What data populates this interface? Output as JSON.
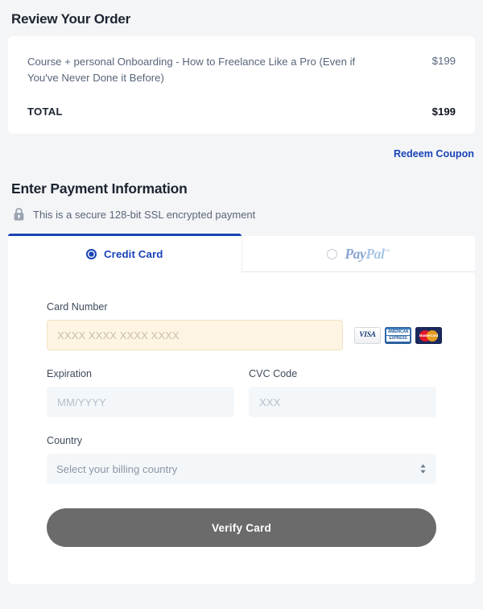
{
  "review": {
    "title": "Review Your Order",
    "item_name": "Course + personal Onboarding - How to Freelance Like a Pro (Even if You've Never Done it Before)",
    "item_price": "$199",
    "total_label": "TOTAL",
    "total_price": "$199"
  },
  "coupon": {
    "label": "Redeem Coupon",
    "color": "#1a43b8"
  },
  "payment": {
    "title": "Enter Payment Information",
    "ssl_notice": "This is a secure 128-bit SSL encrypted payment",
    "lock_icon": "lock-icon"
  },
  "tabs": [
    {
      "id": "credit-card",
      "label": "Credit Card",
      "selected": true,
      "radio_icon": "radio-selected-icon"
    },
    {
      "id": "paypal",
      "label": "PayPal",
      "logo_pay": "Pay",
      "logo_pal": "Pal",
      "trademark": "™",
      "selected": false,
      "radio_icon": "radio-unselected-icon"
    }
  ],
  "form": {
    "card_number": {
      "label": "Card Number",
      "placeholder": "XXXX XXXX XXXX XXXX",
      "value": "",
      "focused": true
    },
    "expiration": {
      "label": "Expiration",
      "placeholder": "MM/YYYY",
      "value": ""
    },
    "cvc": {
      "label": "CVC Code",
      "placeholder": "XXX",
      "value": ""
    },
    "country": {
      "label": "Country",
      "selected_text": "Select your billing country"
    },
    "submit_label": "Verify Card"
  },
  "card_brands": [
    {
      "name": "visa",
      "text": "VISA"
    },
    {
      "name": "amex",
      "line1": "AMERICAN",
      "line2": "EXPRESS"
    },
    {
      "name": "mastercard",
      "text": "MasterCard"
    }
  ],
  "colors": {
    "page_bg": "#f4f5f7",
    "card_bg": "#ffffff",
    "accent_blue": "#1a43b8",
    "input_bg": "#f4f7fa",
    "input_focus_bg": "#fdf4e3",
    "button_bg": "#6b6b6b"
  }
}
